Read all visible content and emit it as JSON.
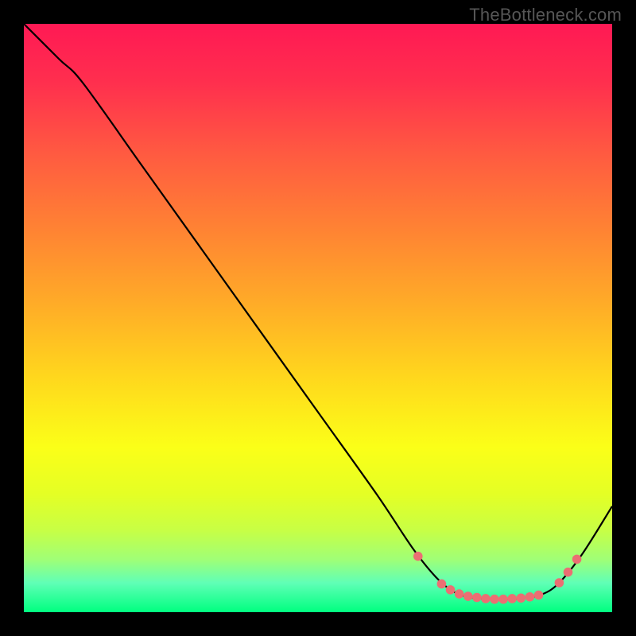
{
  "watermark": "TheBottleneck.com",
  "colors": {
    "marker": "#eb6f73",
    "curve": "#000000",
    "gradient_stops": [
      {
        "offset": 0.0,
        "color": "#ff1954"
      },
      {
        "offset": 0.1,
        "color": "#ff2f4e"
      },
      {
        "offset": 0.22,
        "color": "#ff5a41"
      },
      {
        "offset": 0.35,
        "color": "#ff8333"
      },
      {
        "offset": 0.48,
        "color": "#ffad27"
      },
      {
        "offset": 0.6,
        "color": "#ffd71d"
      },
      {
        "offset": 0.72,
        "color": "#fbff18"
      },
      {
        "offset": 0.8,
        "color": "#e4ff25"
      },
      {
        "offset": 0.86,
        "color": "#c8ff44"
      },
      {
        "offset": 0.91,
        "color": "#a0ff76"
      },
      {
        "offset": 0.95,
        "color": "#60ffb6"
      },
      {
        "offset": 1.0,
        "color": "#00ff80"
      }
    ]
  },
  "chart_data": {
    "type": "line",
    "title": "",
    "xlabel": "",
    "ylabel": "",
    "xlim": [
      0,
      100
    ],
    "ylim": [
      0,
      100
    ],
    "curve": [
      {
        "x": 0,
        "y": 100
      },
      {
        "x": 6,
        "y": 94
      },
      {
        "x": 10,
        "y": 90
      },
      {
        "x": 20,
        "y": 76
      },
      {
        "x": 30,
        "y": 62
      },
      {
        "x": 40,
        "y": 48
      },
      {
        "x": 50,
        "y": 34
      },
      {
        "x": 60,
        "y": 20
      },
      {
        "x": 66,
        "y": 11
      },
      {
        "x": 70,
        "y": 6
      },
      {
        "x": 73,
        "y": 3.5
      },
      {
        "x": 76,
        "y": 2.5
      },
      {
        "x": 80,
        "y": 2.2
      },
      {
        "x": 84,
        "y": 2.3
      },
      {
        "x": 88,
        "y": 3.0
      },
      {
        "x": 91,
        "y": 5
      },
      {
        "x": 95,
        "y": 10
      },
      {
        "x": 100,
        "y": 18
      }
    ],
    "markers": [
      {
        "x": 67,
        "y": 9.5
      },
      {
        "x": 71,
        "y": 4.8
      },
      {
        "x": 72.5,
        "y": 3.8
      },
      {
        "x": 74,
        "y": 3.1
      },
      {
        "x": 75.5,
        "y": 2.7
      },
      {
        "x": 77,
        "y": 2.5
      },
      {
        "x": 78.5,
        "y": 2.3
      },
      {
        "x": 80,
        "y": 2.2
      },
      {
        "x": 81.5,
        "y": 2.2
      },
      {
        "x": 83,
        "y": 2.3
      },
      {
        "x": 84.5,
        "y": 2.4
      },
      {
        "x": 86,
        "y": 2.6
      },
      {
        "x": 87.5,
        "y": 2.9
      },
      {
        "x": 91,
        "y": 5.0
      },
      {
        "x": 92.5,
        "y": 6.8
      },
      {
        "x": 94,
        "y": 9.0
      }
    ]
  }
}
